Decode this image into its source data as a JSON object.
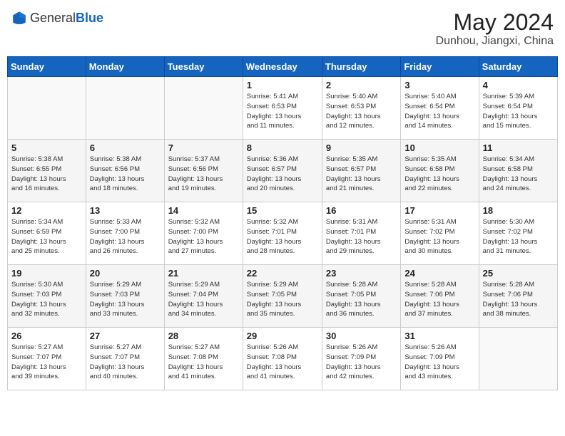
{
  "header": {
    "logo_general": "General",
    "logo_blue": "Blue",
    "month_year": "May 2024",
    "location": "Dunhou, Jiangxi, China"
  },
  "weekdays": [
    "Sunday",
    "Monday",
    "Tuesday",
    "Wednesday",
    "Thursday",
    "Friday",
    "Saturday"
  ],
  "weeks": [
    [
      {
        "day": "",
        "info": ""
      },
      {
        "day": "",
        "info": ""
      },
      {
        "day": "",
        "info": ""
      },
      {
        "day": "1",
        "info": "Sunrise: 5:41 AM\nSunset: 6:53 PM\nDaylight: 13 hours\nand 11 minutes."
      },
      {
        "day": "2",
        "info": "Sunrise: 5:40 AM\nSunset: 6:53 PM\nDaylight: 13 hours\nand 12 minutes."
      },
      {
        "day": "3",
        "info": "Sunrise: 5:40 AM\nSunset: 6:54 PM\nDaylight: 13 hours\nand 14 minutes."
      },
      {
        "day": "4",
        "info": "Sunrise: 5:39 AM\nSunset: 6:54 PM\nDaylight: 13 hours\nand 15 minutes."
      }
    ],
    [
      {
        "day": "5",
        "info": "Sunrise: 5:38 AM\nSunset: 6:55 PM\nDaylight: 13 hours\nand 16 minutes."
      },
      {
        "day": "6",
        "info": "Sunrise: 5:38 AM\nSunset: 6:56 PM\nDaylight: 13 hours\nand 18 minutes."
      },
      {
        "day": "7",
        "info": "Sunrise: 5:37 AM\nSunset: 6:56 PM\nDaylight: 13 hours\nand 19 minutes."
      },
      {
        "day": "8",
        "info": "Sunrise: 5:36 AM\nSunset: 6:57 PM\nDaylight: 13 hours\nand 20 minutes."
      },
      {
        "day": "9",
        "info": "Sunrise: 5:35 AM\nSunset: 6:57 PM\nDaylight: 13 hours\nand 21 minutes."
      },
      {
        "day": "10",
        "info": "Sunrise: 5:35 AM\nSunset: 6:58 PM\nDaylight: 13 hours\nand 22 minutes."
      },
      {
        "day": "11",
        "info": "Sunrise: 5:34 AM\nSunset: 6:58 PM\nDaylight: 13 hours\nand 24 minutes."
      }
    ],
    [
      {
        "day": "12",
        "info": "Sunrise: 5:34 AM\nSunset: 6:59 PM\nDaylight: 13 hours\nand 25 minutes."
      },
      {
        "day": "13",
        "info": "Sunrise: 5:33 AM\nSunset: 7:00 PM\nDaylight: 13 hours\nand 26 minutes."
      },
      {
        "day": "14",
        "info": "Sunrise: 5:32 AM\nSunset: 7:00 PM\nDaylight: 13 hours\nand 27 minutes."
      },
      {
        "day": "15",
        "info": "Sunrise: 5:32 AM\nSunset: 7:01 PM\nDaylight: 13 hours\nand 28 minutes."
      },
      {
        "day": "16",
        "info": "Sunrise: 5:31 AM\nSunset: 7:01 PM\nDaylight: 13 hours\nand 29 minutes."
      },
      {
        "day": "17",
        "info": "Sunrise: 5:31 AM\nSunset: 7:02 PM\nDaylight: 13 hours\nand 30 minutes."
      },
      {
        "day": "18",
        "info": "Sunrise: 5:30 AM\nSunset: 7:02 PM\nDaylight: 13 hours\nand 31 minutes."
      }
    ],
    [
      {
        "day": "19",
        "info": "Sunrise: 5:30 AM\nSunset: 7:03 PM\nDaylight: 13 hours\nand 32 minutes."
      },
      {
        "day": "20",
        "info": "Sunrise: 5:29 AM\nSunset: 7:03 PM\nDaylight: 13 hours\nand 33 minutes."
      },
      {
        "day": "21",
        "info": "Sunrise: 5:29 AM\nSunset: 7:04 PM\nDaylight: 13 hours\nand 34 minutes."
      },
      {
        "day": "22",
        "info": "Sunrise: 5:29 AM\nSunset: 7:05 PM\nDaylight: 13 hours\nand 35 minutes."
      },
      {
        "day": "23",
        "info": "Sunrise: 5:28 AM\nSunset: 7:05 PM\nDaylight: 13 hours\nand 36 minutes."
      },
      {
        "day": "24",
        "info": "Sunrise: 5:28 AM\nSunset: 7:06 PM\nDaylight: 13 hours\nand 37 minutes."
      },
      {
        "day": "25",
        "info": "Sunrise: 5:28 AM\nSunset: 7:06 PM\nDaylight: 13 hours\nand 38 minutes."
      }
    ],
    [
      {
        "day": "26",
        "info": "Sunrise: 5:27 AM\nSunset: 7:07 PM\nDaylight: 13 hours\nand 39 minutes."
      },
      {
        "day": "27",
        "info": "Sunrise: 5:27 AM\nSunset: 7:07 PM\nDaylight: 13 hours\nand 40 minutes."
      },
      {
        "day": "28",
        "info": "Sunrise: 5:27 AM\nSunset: 7:08 PM\nDaylight: 13 hours\nand 41 minutes."
      },
      {
        "day": "29",
        "info": "Sunrise: 5:26 AM\nSunset: 7:08 PM\nDaylight: 13 hours\nand 41 minutes."
      },
      {
        "day": "30",
        "info": "Sunrise: 5:26 AM\nSunset: 7:09 PM\nDaylight: 13 hours\nand 42 minutes."
      },
      {
        "day": "31",
        "info": "Sunrise: 5:26 AM\nSunset: 7:09 PM\nDaylight: 13 hours\nand 43 minutes."
      },
      {
        "day": "",
        "info": ""
      }
    ]
  ]
}
